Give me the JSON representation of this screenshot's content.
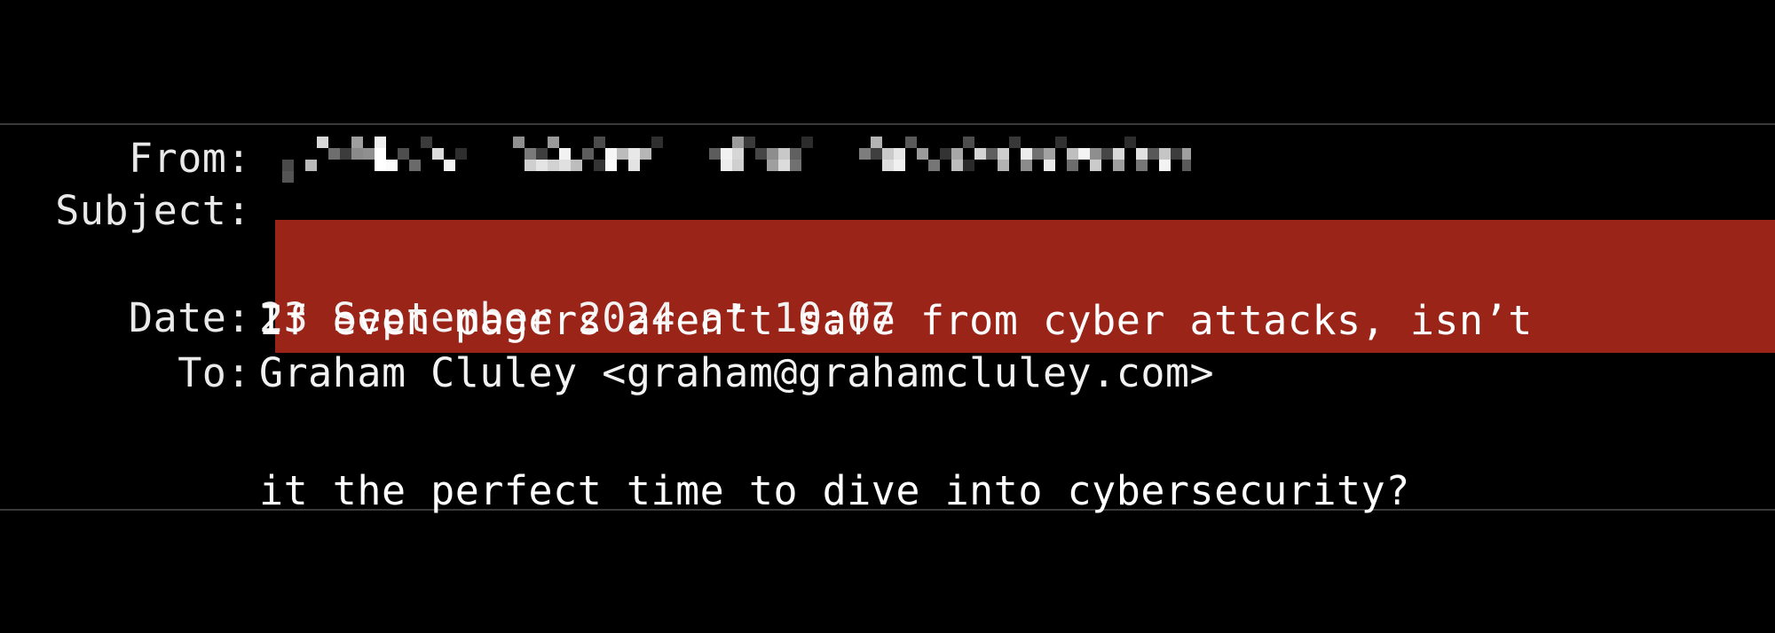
{
  "window": {
    "background_color": "#000000",
    "divider_color": "#3a3a3a"
  },
  "email_header": {
    "fields": [
      {
        "label": "From:",
        "name": "from",
        "value": "",
        "redacted": true,
        "redaction_style": "pixelated"
      },
      {
        "label": "Subject:",
        "name": "subject",
        "value": "If even pagers aren’t safe from cyber attacks, isn’t it the perfect time to dive into cybersecurity?",
        "lines": [
          "If even pagers aren’t safe from cyber attacks, isn’t",
          "it the perfect time to dive into cybersecurity?"
        ],
        "highlighted": true,
        "highlight_color": "#9a2417",
        "text_color": "#ffffff"
      },
      {
        "label": "Date:",
        "name": "date",
        "value": "23 September 2024 at 10:07",
        "redacted": false
      },
      {
        "label": "To:",
        "name": "to",
        "value": "Graham Cluley <graham@grahamcluley.com>",
        "redacted": false
      }
    ]
  },
  "redaction": {
    "block_size": 13,
    "blocks": [
      [
        2,
        2,
        "#4a4a4a"
      ],
      [
        5,
        0,
        "#d8d8d8"
      ],
      [
        2,
        3,
        "#555555"
      ],
      [
        4,
        2,
        "#b9b9b9"
      ],
      [
        6,
        1,
        "#6e6e6e"
      ],
      [
        7,
        1,
        "#3c3c3c"
      ],
      [
        8,
        0,
        "#9e9e9e"
      ],
      [
        8,
        1,
        "#8a8a8a"
      ],
      [
        9,
        1,
        "#8f8f8f"
      ],
      [
        10,
        0,
        "#f0f0f0"
      ],
      [
        10,
        1,
        "#ffffff"
      ],
      [
        10,
        2,
        "#ffffff"
      ],
      [
        11,
        2,
        "#fbfbfb"
      ],
      [
        12,
        1,
        "#4e4e4e"
      ],
      [
        13,
        2,
        "#6a6a6a"
      ],
      [
        14,
        0,
        "#3b3b3b"
      ],
      [
        15,
        1,
        "#dcdcdc"
      ],
      [
        16,
        2,
        "#f4f4f4"
      ],
      [
        17,
        1,
        "#2e2e2e"
      ],
      [
        22,
        0,
        "#8f8f8f"
      ],
      [
        23,
        1,
        "#7a7a7a"
      ],
      [
        23,
        2,
        "#cfcfcf"
      ],
      [
        24,
        1,
        "#3e3e3e"
      ],
      [
        24,
        2,
        "#e4e4e4"
      ],
      [
        25,
        0,
        "#9a9a9a"
      ],
      [
        25,
        2,
        "#d2d2d2"
      ],
      [
        26,
        1,
        "#f2f2f2"
      ],
      [
        26,
        2,
        "#e0e0e0"
      ],
      [
        27,
        2,
        "#bdbdbd"
      ],
      [
        28,
        1,
        "#5d5d5d"
      ],
      [
        29,
        0,
        "#4b4b4b"
      ],
      [
        29,
        2,
        "#343434"
      ],
      [
        30,
        1,
        "#f6f6f6"
      ],
      [
        30,
        2,
        "#fafafa"
      ],
      [
        31,
        1,
        "#bcbcbc"
      ],
      [
        32,
        1,
        "#e8e8e8"
      ],
      [
        32,
        2,
        "#e3e3e3"
      ],
      [
        33,
        1,
        "#b6b6b6"
      ],
      [
        34,
        0,
        "#2f2f2f"
      ],
      [
        39,
        1,
        "#5c5c5c"
      ],
      [
        40,
        1,
        "#f1f1f1"
      ],
      [
        40,
        2,
        "#ededed"
      ],
      [
        41,
        0,
        "#9c9c9c"
      ],
      [
        41,
        1,
        "#d6d6d6"
      ],
      [
        41,
        2,
        "#cfcfcf"
      ],
      [
        42,
        0,
        "#3a3a3a"
      ],
      [
        43,
        1,
        "#464646"
      ],
      [
        44,
        1,
        "#8d8d8d"
      ],
      [
        44,
        2,
        "#9f9f9f"
      ],
      [
        45,
        1,
        "#c8c8c8"
      ],
      [
        45,
        2,
        "#dcdcdc"
      ],
      [
        46,
        1,
        "#606060"
      ],
      [
        46,
        2,
        "#717171"
      ],
      [
        47,
        0,
        "#2c2c2c"
      ],
      [
        52,
        1,
        "#7d7d7d"
      ],
      [
        53,
        0,
        "#b4b4b4"
      ],
      [
        53,
        1,
        "#3f3f3f"
      ],
      [
        54,
        1,
        "#cacaca"
      ],
      [
        54,
        2,
        "#dddddd"
      ],
      [
        55,
        1,
        "#e6e6e6"
      ],
      [
        55,
        2,
        "#f0f0f0"
      ],
      [
        56,
        0,
        "#5a5a5a"
      ],
      [
        57,
        1,
        "#9b9b9b"
      ],
      [
        58,
        2,
        "#767676"
      ],
      [
        59,
        1,
        "#333333"
      ],
      [
        60,
        1,
        "#a7a7a7"
      ],
      [
        60,
        2,
        "#bdbdbd"
      ],
      [
        61,
        0,
        "#4d4d4d"
      ],
      [
        61,
        2,
        "#2a2a2a"
      ],
      [
        62,
        1,
        "#d4d4d4"
      ],
      [
        63,
        1,
        "#5f5f5f"
      ],
      [
        64,
        1,
        "#cdcdcd"
      ],
      [
        64,
        2,
        "#b2b2b2"
      ],
      [
        65,
        0,
        "#383838"
      ],
      [
        66,
        1,
        "#ececec"
      ],
      [
        66,
        2,
        "#8b8b8b"
      ],
      [
        67,
        1,
        "#717171"
      ],
      [
        68,
        1,
        "#a2a2a2"
      ],
      [
        68,
        2,
        "#e9e9e9"
      ],
      [
        69,
        0,
        "#313131"
      ],
      [
        70,
        1,
        "#bfbfbf"
      ],
      [
        70,
        2,
        "#6c6c6c"
      ],
      [
        71,
        1,
        "#f4f4f4"
      ],
      [
        72,
        1,
        "#8e8e8e"
      ],
      [
        72,
        2,
        "#cbcbcb"
      ],
      [
        73,
        1,
        "#464646"
      ],
      [
        74,
        1,
        "#d9d9d9"
      ],
      [
        74,
        2,
        "#9d9d9d"
      ],
      [
        75,
        0,
        "#2d2d2d"
      ],
      [
        76,
        1,
        "#e1e1e1"
      ],
      [
        76,
        2,
        "#777777"
      ],
      [
        77,
        1,
        "#585858"
      ],
      [
        78,
        1,
        "#c5c5c5"
      ],
      [
        78,
        2,
        "#f3f3f3"
      ],
      [
        79,
        1,
        "#3c3c3c"
      ],
      [
        80,
        1,
        "#9f9f9f"
      ],
      [
        80,
        2,
        "#5b5b5b"
      ],
      [
        81,
        0,
        "#272727"
      ],
      [
        86,
        1,
        "#6b6b6b"
      ],
      [
        87,
        0,
        "#aeaeae"
      ],
      [
        87,
        2,
        "#3e3e3e"
      ],
      [
        88,
        1,
        "#dfdfdf"
      ],
      [
        88,
        2,
        "#c4c4c4"
      ],
      [
        89,
        1,
        "#8c8c8c"
      ],
      [
        90,
        0,
        "#353535"
      ],
      [
        91,
        1,
        "#f7f7f7"
      ],
      [
        91,
        2,
        "#a9a9a9"
      ],
      [
        92,
        1,
        "#4f4f4f"
      ],
      [
        93,
        1,
        "#cecece"
      ],
      [
        93,
        2,
        "#e7e7e7"
      ],
      [
        94,
        0,
        "#2b2b2b"
      ],
      [
        95,
        1,
        "#7f7f7f"
      ],
      [
        95,
        2,
        "#939393"
      ]
    ]
  }
}
